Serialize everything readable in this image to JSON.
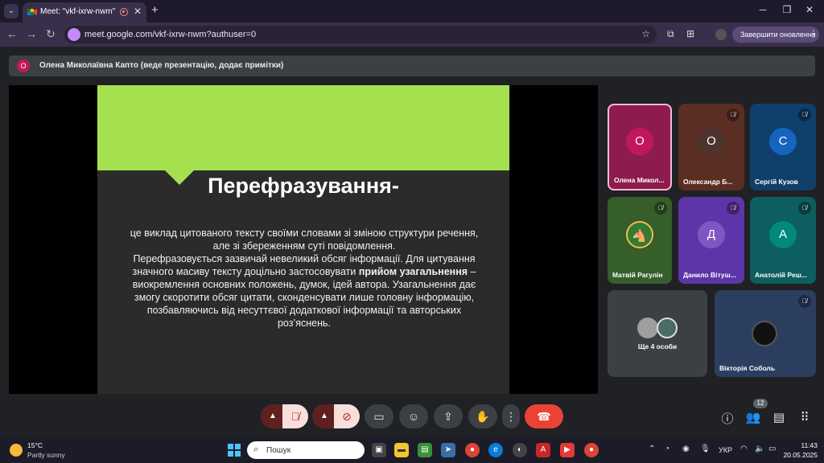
{
  "browser": {
    "tab_title": "Meet: \"vkf-ixrw-nwm\"",
    "url": "meet.google.com/vkf-ixrw-nwm?authuser=0",
    "update_label": "Завершити оновлення"
  },
  "presenter": {
    "initial": "О",
    "text": "Олена Миколаївна Капто (веде презентацію, додає примітки)"
  },
  "slide": {
    "heading": "Перефразування-",
    "line1": "це виклад цитованого тексту своїми словами зі зміною структури речення, але зі збереженням суті повідомлення.",
    "line2": "Перефразовується зазвичай невеликий обсяг інформації.  Для цитування значного масиву тексту доцільно застосовувати",
    "bold": "прийом узагальнення",
    "line3": " – виокремлення основних положень, думок, ідей автора. Узагальнення дає змогу скоротити обсяг цитати, сконденсувати лише головну інформацію, позбавляючись від несуттєвої додаткової інформації та авторських роз’яснень.",
    "colors": {
      "band": "#a5e04f",
      "background": "#2b2b2b"
    }
  },
  "participants": [
    {
      "initial": "О",
      "name": "Олена Микол...",
      "color": "#c2185b",
      "bg": "#8e1b4f",
      "muted": false
    },
    {
      "initial": "О",
      "name": "Олександр Б...",
      "color": "#5d4037",
      "bg": "#5a2e22",
      "muted": true
    },
    {
      "initial": "С",
      "name": "Сергій Кузов",
      "color": "#1565c0",
      "bg": "#0f3f6b",
      "muted": true
    },
    {
      "initial": "",
      "name": "Матвій Рагулін",
      "color": "#2e7d32",
      "bg": "#355e2a",
      "muted": true
    },
    {
      "initial": "Д",
      "name": "Данило Вітуш...",
      "color": "#7e57c2",
      "bg": "#5e35a8",
      "muted": true
    },
    {
      "initial": "А",
      "name": "Анатолій Реш...",
      "color": "#00897b",
      "bg": "#0d5e5e",
      "muted": true
    }
  ],
  "more_people": {
    "label": "Ще 4 особи"
  },
  "featured": {
    "name": "Вікторія Соболь",
    "muted": true
  },
  "people_count": "12",
  "taskbar": {
    "temp": "15°C",
    "condition": "Partly sunny",
    "search_placeholder": "Пошук",
    "lang": "УКР",
    "time": "11:43",
    "date": "20.05.2025"
  }
}
